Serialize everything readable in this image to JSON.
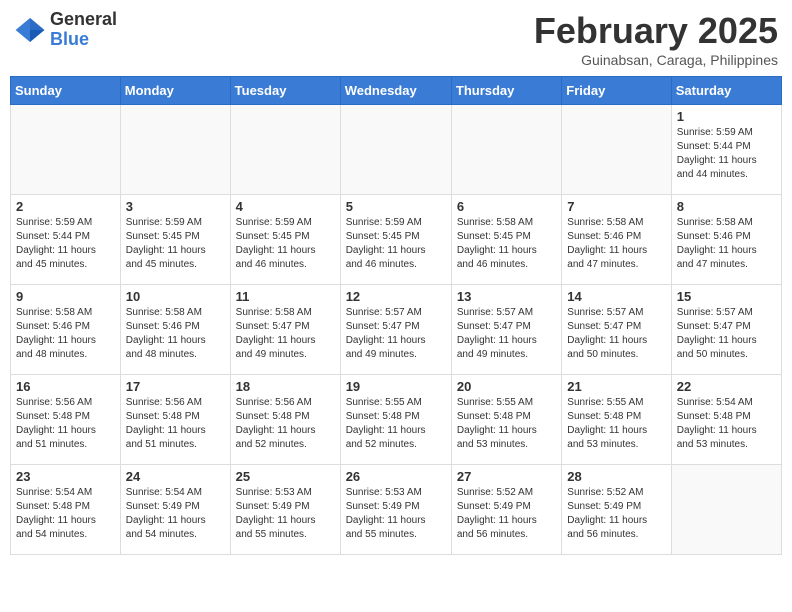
{
  "header": {
    "logo_general": "General",
    "logo_blue": "Blue",
    "month_title": "February 2025",
    "location": "Guinabsan, Caraga, Philippines"
  },
  "days_of_week": [
    "Sunday",
    "Monday",
    "Tuesday",
    "Wednesday",
    "Thursday",
    "Friday",
    "Saturday"
  ],
  "weeks": [
    [
      {
        "day": "",
        "info": ""
      },
      {
        "day": "",
        "info": ""
      },
      {
        "day": "",
        "info": ""
      },
      {
        "day": "",
        "info": ""
      },
      {
        "day": "",
        "info": ""
      },
      {
        "day": "",
        "info": ""
      },
      {
        "day": "1",
        "info": "Sunrise: 5:59 AM\nSunset: 5:44 PM\nDaylight: 11 hours\nand 44 minutes."
      }
    ],
    [
      {
        "day": "2",
        "info": "Sunrise: 5:59 AM\nSunset: 5:44 PM\nDaylight: 11 hours\nand 45 minutes."
      },
      {
        "day": "3",
        "info": "Sunrise: 5:59 AM\nSunset: 5:45 PM\nDaylight: 11 hours\nand 45 minutes."
      },
      {
        "day": "4",
        "info": "Sunrise: 5:59 AM\nSunset: 5:45 PM\nDaylight: 11 hours\nand 46 minutes."
      },
      {
        "day": "5",
        "info": "Sunrise: 5:59 AM\nSunset: 5:45 PM\nDaylight: 11 hours\nand 46 minutes."
      },
      {
        "day": "6",
        "info": "Sunrise: 5:58 AM\nSunset: 5:45 PM\nDaylight: 11 hours\nand 46 minutes."
      },
      {
        "day": "7",
        "info": "Sunrise: 5:58 AM\nSunset: 5:46 PM\nDaylight: 11 hours\nand 47 minutes."
      },
      {
        "day": "8",
        "info": "Sunrise: 5:58 AM\nSunset: 5:46 PM\nDaylight: 11 hours\nand 47 minutes."
      }
    ],
    [
      {
        "day": "9",
        "info": "Sunrise: 5:58 AM\nSunset: 5:46 PM\nDaylight: 11 hours\nand 48 minutes."
      },
      {
        "day": "10",
        "info": "Sunrise: 5:58 AM\nSunset: 5:46 PM\nDaylight: 11 hours\nand 48 minutes."
      },
      {
        "day": "11",
        "info": "Sunrise: 5:58 AM\nSunset: 5:47 PM\nDaylight: 11 hours\nand 49 minutes."
      },
      {
        "day": "12",
        "info": "Sunrise: 5:57 AM\nSunset: 5:47 PM\nDaylight: 11 hours\nand 49 minutes."
      },
      {
        "day": "13",
        "info": "Sunrise: 5:57 AM\nSunset: 5:47 PM\nDaylight: 11 hours\nand 49 minutes."
      },
      {
        "day": "14",
        "info": "Sunrise: 5:57 AM\nSunset: 5:47 PM\nDaylight: 11 hours\nand 50 minutes."
      },
      {
        "day": "15",
        "info": "Sunrise: 5:57 AM\nSunset: 5:47 PM\nDaylight: 11 hours\nand 50 minutes."
      }
    ],
    [
      {
        "day": "16",
        "info": "Sunrise: 5:56 AM\nSunset: 5:48 PM\nDaylight: 11 hours\nand 51 minutes."
      },
      {
        "day": "17",
        "info": "Sunrise: 5:56 AM\nSunset: 5:48 PM\nDaylight: 11 hours\nand 51 minutes."
      },
      {
        "day": "18",
        "info": "Sunrise: 5:56 AM\nSunset: 5:48 PM\nDaylight: 11 hours\nand 52 minutes."
      },
      {
        "day": "19",
        "info": "Sunrise: 5:55 AM\nSunset: 5:48 PM\nDaylight: 11 hours\nand 52 minutes."
      },
      {
        "day": "20",
        "info": "Sunrise: 5:55 AM\nSunset: 5:48 PM\nDaylight: 11 hours\nand 53 minutes."
      },
      {
        "day": "21",
        "info": "Sunrise: 5:55 AM\nSunset: 5:48 PM\nDaylight: 11 hours\nand 53 minutes."
      },
      {
        "day": "22",
        "info": "Sunrise: 5:54 AM\nSunset: 5:48 PM\nDaylight: 11 hours\nand 53 minutes."
      }
    ],
    [
      {
        "day": "23",
        "info": "Sunrise: 5:54 AM\nSunset: 5:48 PM\nDaylight: 11 hours\nand 54 minutes."
      },
      {
        "day": "24",
        "info": "Sunrise: 5:54 AM\nSunset: 5:49 PM\nDaylight: 11 hours\nand 54 minutes."
      },
      {
        "day": "25",
        "info": "Sunrise: 5:53 AM\nSunset: 5:49 PM\nDaylight: 11 hours\nand 55 minutes."
      },
      {
        "day": "26",
        "info": "Sunrise: 5:53 AM\nSunset: 5:49 PM\nDaylight: 11 hours\nand 55 minutes."
      },
      {
        "day": "27",
        "info": "Sunrise: 5:52 AM\nSunset: 5:49 PM\nDaylight: 11 hours\nand 56 minutes."
      },
      {
        "day": "28",
        "info": "Sunrise: 5:52 AM\nSunset: 5:49 PM\nDaylight: 11 hours\nand 56 minutes."
      },
      {
        "day": "",
        "info": ""
      }
    ]
  ]
}
